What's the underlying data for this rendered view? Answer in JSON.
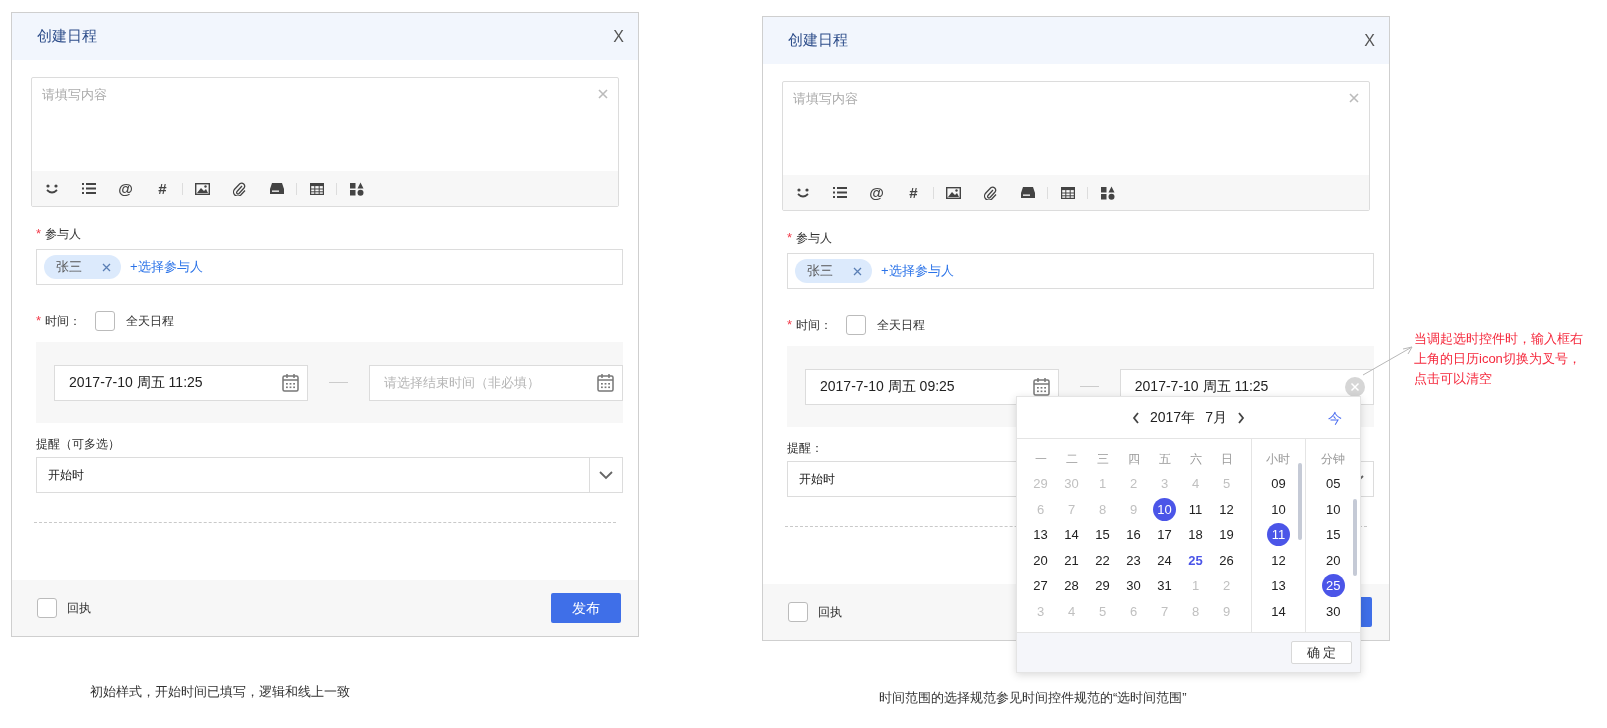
{
  "dialogs": [
    {
      "title": "创建日程",
      "close": "X",
      "editor": {
        "placeholder": "请填写内容"
      },
      "toolbar_glyphs": [
        "@",
        "#"
      ],
      "participants": {
        "required_mark": "*",
        "label": "参与人",
        "chips": [
          {
            "name": "张三"
          }
        ],
        "add_link": "+选择参与人"
      },
      "time": {
        "required_mark": "*",
        "label": "时间：",
        "all_day": {
          "label": "全天日程",
          "checked": false
        },
        "start": {
          "value": "2017-7-10 周五 11:25",
          "clearable": false
        },
        "end": {
          "placeholder": "请选择结束时间（非必填）",
          "clearable": false
        }
      },
      "reminder": {
        "label": "提醒（可多选）",
        "value": "开始时"
      },
      "receipt": {
        "label": "回执",
        "checked": false
      },
      "publish_label": "发布",
      "caption": "初始样式，开始时间已填写，逻辑和线上一致"
    },
    {
      "title": "创建日程",
      "close": "X",
      "editor": {
        "placeholder": "请填写内容"
      },
      "toolbar_glyphs": [
        "@",
        "#"
      ],
      "participants": {
        "required_mark": "*",
        "label": "参与人",
        "chips": [
          {
            "name": "张三"
          }
        ],
        "add_link": "+选择参与人"
      },
      "time": {
        "required_mark": "*",
        "label": "时间：",
        "all_day": {
          "label": "全天日程",
          "checked": false
        },
        "start": {
          "value": "2017-7-10 周五 09:25",
          "clearable": false
        },
        "end": {
          "value": "2017-7-10 周五 11:25",
          "clearable": true
        }
      },
      "reminder": {
        "label": "提醒：",
        "value": "开始时"
      },
      "receipt": {
        "label": "回执",
        "checked": false
      },
      "picker": {
        "year": "2017年",
        "month": "7月",
        "today": "今",
        "weekdays": [
          "一",
          "二",
          "三",
          "四",
          "五",
          "六",
          "日"
        ],
        "weeks": [
          [
            {
              "d": "29",
              "disabled": true,
              "selected": false,
              "today": false
            },
            {
              "d": "30",
              "disabled": true,
              "selected": false,
              "today": false
            },
            {
              "d": "1",
              "disabled": true,
              "selected": false,
              "today": false
            },
            {
              "d": "2",
              "disabled": true,
              "selected": false,
              "today": false
            },
            {
              "d": "3",
              "disabled": true,
              "selected": false,
              "today": false
            },
            {
              "d": "4",
              "disabled": true,
              "selected": false,
              "today": false
            },
            {
              "d": "5",
              "disabled": true,
              "selected": false,
              "today": false
            }
          ],
          [
            {
              "d": "6",
              "disabled": true,
              "selected": false,
              "today": false
            },
            {
              "d": "7",
              "disabled": true,
              "selected": false,
              "today": false
            },
            {
              "d": "8",
              "disabled": true,
              "selected": false,
              "today": false
            },
            {
              "d": "9",
              "disabled": true,
              "selected": false,
              "today": false
            },
            {
              "d": "10",
              "disabled": false,
              "selected": true,
              "today": false
            },
            {
              "d": "11",
              "disabled": false,
              "selected": false,
              "today": false
            },
            {
              "d": "12",
              "disabled": false,
              "selected": false,
              "today": false
            }
          ],
          [
            {
              "d": "13",
              "disabled": false,
              "selected": false,
              "today": false
            },
            {
              "d": "14",
              "disabled": false,
              "selected": false,
              "today": false
            },
            {
              "d": "15",
              "disabled": false,
              "selected": false,
              "today": false
            },
            {
              "d": "16",
              "disabled": false,
              "selected": false,
              "today": false
            },
            {
              "d": "17",
              "disabled": false,
              "selected": false,
              "today": false
            },
            {
              "d": "18",
              "disabled": false,
              "selected": false,
              "today": false
            },
            {
              "d": "19",
              "disabled": false,
              "selected": false,
              "today": false
            }
          ],
          [
            {
              "d": "20",
              "disabled": false,
              "selected": false,
              "today": false
            },
            {
              "d": "21",
              "disabled": false,
              "selected": false,
              "today": false
            },
            {
              "d": "22",
              "disabled": false,
              "selected": false,
              "today": false
            },
            {
              "d": "23",
              "disabled": false,
              "selected": false,
              "today": false
            },
            {
              "d": "24",
              "disabled": false,
              "selected": false,
              "today": false
            },
            {
              "d": "25",
              "disabled": false,
              "selected": false,
              "today": true
            },
            {
              "d": "26",
              "disabled": false,
              "selected": false,
              "today": false
            }
          ],
          [
            {
              "d": "27",
              "disabled": false,
              "selected": false,
              "today": false
            },
            {
              "d": "28",
              "disabled": false,
              "selected": false,
              "today": false
            },
            {
              "d": "29",
              "disabled": false,
              "selected": false,
              "today": false
            },
            {
              "d": "30",
              "disabled": false,
              "selected": false,
              "today": false
            },
            {
              "d": "31",
              "disabled": false,
              "selected": false,
              "today": false
            },
            {
              "d": "1",
              "disabled": true,
              "selected": false,
              "today": false
            },
            {
              "d": "2",
              "disabled": true,
              "selected": false,
              "today": false
            }
          ],
          [
            {
              "d": "3",
              "disabled": true,
              "selected": false,
              "today": false
            },
            {
              "d": "4",
              "disabled": true,
              "selected": false,
              "today": false
            },
            {
              "d": "5",
              "disabled": true,
              "selected": false,
              "today": false
            },
            {
              "d": "6",
              "disabled": true,
              "selected": false,
              "today": false
            },
            {
              "d": "7",
              "disabled": true,
              "selected": false,
              "today": false
            },
            {
              "d": "8",
              "disabled": true,
              "selected": false,
              "today": false
            },
            {
              "d": "9",
              "disabled": true,
              "selected": false,
              "today": false
            }
          ]
        ],
        "hour_heading": "小时",
        "hours": [
          {
            "text": "09",
            "selected": false
          },
          {
            "text": "10",
            "selected": false
          },
          {
            "text": "11",
            "selected": true
          },
          {
            "text": "12",
            "selected": false
          },
          {
            "text": "13",
            "selected": false
          },
          {
            "text": "14",
            "selected": false
          }
        ],
        "minute_heading": "分钟",
        "minutes": [
          {
            "text": "05",
            "selected": false
          },
          {
            "text": "10",
            "selected": false
          },
          {
            "text": "15",
            "selected": false
          },
          {
            "text": "20",
            "selected": false
          },
          {
            "text": "25",
            "selected": true
          },
          {
            "text": "30",
            "selected": false
          }
        ],
        "confirm": "确 定"
      },
      "caption": "时间范围的选择规范参见时间控件规范的“选时间范围”"
    }
  ],
  "annotation": "当调起选时控件时，输入框右上角的日历icon切换为叉号，点击可以清空"
}
